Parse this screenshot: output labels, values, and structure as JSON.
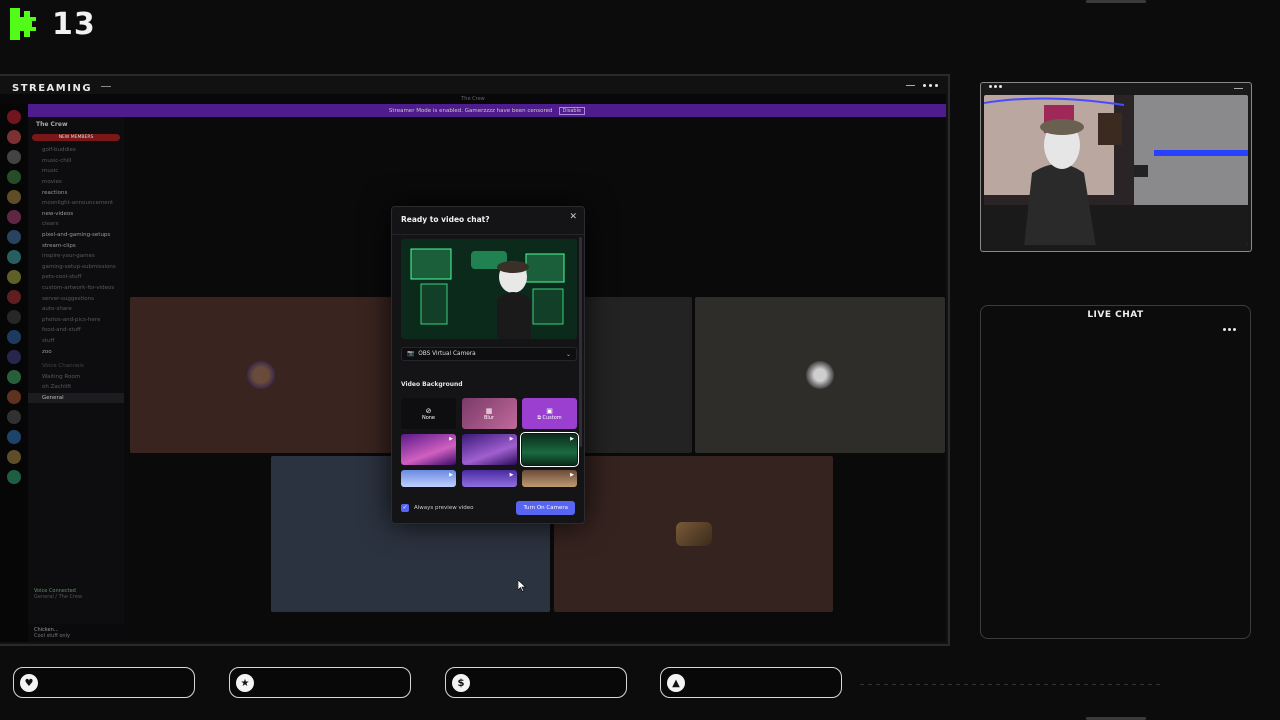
{
  "brand": {
    "number": "13",
    "logo_color": "#53fc18"
  },
  "stream_panel": {
    "title": "STREAMING"
  },
  "discord": {
    "window_title": "The Crew",
    "banner_text": "Streamer Mode is enabled. Gamerzzzz have been censored",
    "banner_button": "Disable",
    "server_name": "The Crew",
    "event_badge": "NEW MEMBERS",
    "channels": [
      {
        "label": "golf-buddies",
        "bold": false
      },
      {
        "label": "music-chill",
        "bold": false
      },
      {
        "label": "music",
        "bold": false
      },
      {
        "label": "movies",
        "bold": false
      },
      {
        "label": "reactions",
        "bold": true
      },
      {
        "label": "moonlight-announcement",
        "bold": false
      },
      {
        "label": "new-videos",
        "bold": true
      },
      {
        "label": "clears",
        "bold": false
      },
      {
        "label": "pixel-and-gaming-setups",
        "bold": true
      },
      {
        "label": "stream-clips",
        "bold": true
      },
      {
        "label": "inspire-your-games",
        "bold": false
      },
      {
        "label": "gaming-setup-submissions",
        "bold": false
      },
      {
        "label": "pets-cool-stuff",
        "bold": false
      },
      {
        "label": "custom-artwork-for-videos",
        "bold": false
      },
      {
        "label": "server-suggestions",
        "bold": false
      },
      {
        "label": "auto-share",
        "bold": false
      },
      {
        "label": "photos-and-pics-here",
        "bold": false
      },
      {
        "label": "food-and-stuff",
        "bold": false
      },
      {
        "label": "stuff",
        "bold": false
      },
      {
        "label": "zoo",
        "bold": true
      }
    ],
    "voice_category": "Voice Channels",
    "voice_channels": [
      {
        "label": "Waiting Room",
        "selected": false
      },
      {
        "label": "oh Zachlift",
        "selected": false
      },
      {
        "label": "General",
        "selected": true
      }
    ],
    "voice_status": "Voice Connected",
    "voice_sub": "General / The Crew",
    "username": "Chicken...",
    "user_status": "Cool stuff only"
  },
  "modal": {
    "title": "Ready to video chat?",
    "camera_source": "OBS Virtual Camera",
    "section_label": "Video Background",
    "options": [
      {
        "label": "None",
        "symbol": "⊘",
        "kind": "none"
      },
      {
        "label": "Blur",
        "symbol": "▦",
        "kind": "blur"
      },
      {
        "label": "⧉ Custom",
        "symbol": "▣",
        "kind": "custom"
      }
    ],
    "always_preview_label": "Always preview video",
    "always_preview_checked": true,
    "primary_button": "Turn On Camera"
  },
  "live_chat": {
    "title": "LIVE CHAT"
  },
  "bottom_actions": [
    {
      "icon": "heart-icon",
      "glyph": "♥"
    },
    {
      "icon": "star-icon",
      "glyph": "★"
    },
    {
      "icon": "dollar-icon",
      "glyph": "$"
    },
    {
      "icon": "triangle-icon",
      "glyph": "▲"
    }
  ],
  "colors": {
    "accent": "#5865f2",
    "banner": "#4e1c8c",
    "kick_green": "#53fc18"
  }
}
